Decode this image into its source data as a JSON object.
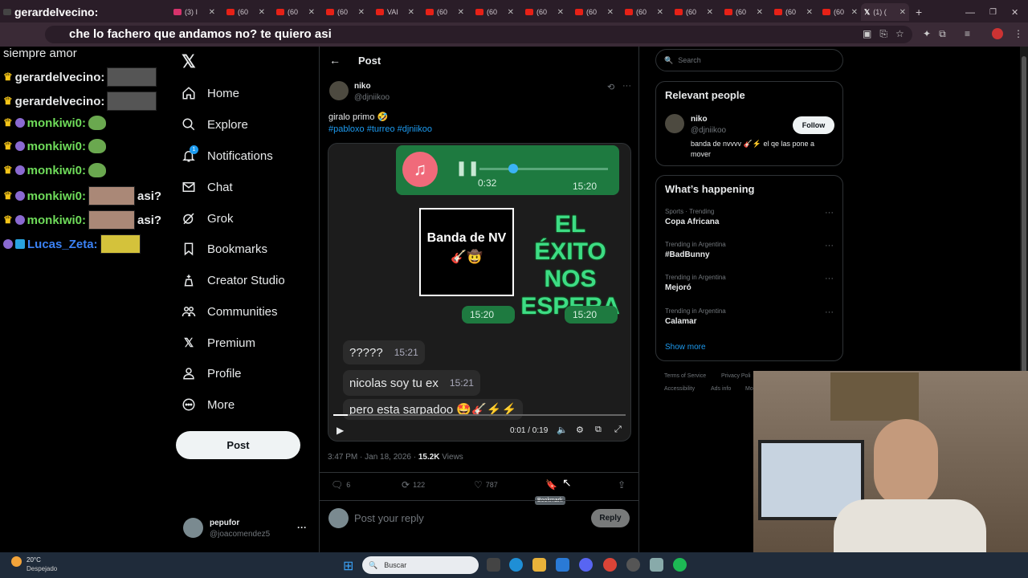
{
  "browser": {
    "tabs": [
      {
        "label": "gerardelvecino:"
      },
      {
        "label": "(3) I"
      },
      {
        "label": "(60"
      },
      {
        "label": "(60"
      },
      {
        "label": "(60"
      },
      {
        "label": "VAI"
      },
      {
        "label": "(60"
      },
      {
        "label": "(60"
      },
      {
        "label": "(60"
      },
      {
        "label": "(60"
      },
      {
        "label": "(60"
      },
      {
        "label": "(60"
      },
      {
        "label": "(60"
      },
      {
        "label": "(60"
      },
      {
        "label": "(60"
      },
      {
        "label": "(60"
      },
      {
        "label": "(60"
      }
    ],
    "active_tab": "(1) (",
    "new_tab": "+",
    "address_overlay": "che lo fachero que andamos no? te quiero asi"
  },
  "stream_chat": {
    "lines": [
      {
        "user": "",
        "text": "siempre amor"
      },
      {
        "user": "gerardelvecino:"
      },
      {
        "user": "gerardelvecino:"
      },
      {
        "user": "monkiwi0:"
      },
      {
        "user": "monkiwi0:"
      },
      {
        "user": "monkiwi0:"
      },
      {
        "user": "monkiwi0:",
        "text": "asi?"
      },
      {
        "user": "monkiwi0:",
        "text": "asi?"
      },
      {
        "user": "Lucas_Zeta:"
      }
    ]
  },
  "nav": {
    "items": [
      {
        "label": "Home",
        "icon": "home-icon"
      },
      {
        "label": "Explore",
        "icon": "search-icon"
      },
      {
        "label": "Notifications",
        "icon": "bell-icon",
        "badge": "1"
      },
      {
        "label": "Chat",
        "icon": "mail-icon"
      },
      {
        "label": "Grok",
        "icon": "grok-icon"
      },
      {
        "label": "Bookmarks",
        "icon": "bookmark-icon"
      },
      {
        "label": "Creator Studio",
        "icon": "creator-icon"
      },
      {
        "label": "Communities",
        "icon": "communities-icon"
      },
      {
        "label": "Premium",
        "icon": "x-icon"
      },
      {
        "label": "Profile",
        "icon": "person-icon"
      },
      {
        "label": "More",
        "icon": "more-icon"
      }
    ],
    "post_button": "Post",
    "account": {
      "name": "pepufor",
      "handle": "@joacomendez5",
      "more": "···"
    }
  },
  "post": {
    "header": "Post",
    "author": {
      "name": "niko",
      "handle": "@djniikoo"
    },
    "text": "giralo primo 🤣",
    "hashtags": "#pabloxo #turreo #djniikoo",
    "media": {
      "audio_time": "0:32",
      "bubble_time": "15:20",
      "sticker_text": "Banda de NV 🎸🤠",
      "big_text": "EL ÉXITO NOS ESPERA",
      "time_a": "15:20",
      "time_b": "15:20",
      "msg1": "?????",
      "msg1_time": "15:21",
      "msg2": "nicolas soy tu ex",
      "msg2_time": "15:21",
      "caption": "pero esta sarpadoo 🤩🎸⚡⚡",
      "video_time": "0:01 / 0:19",
      "progress": 0.05
    },
    "meta": {
      "time": "3:47 PM · Jan 18, 2026 · ",
      "views_count": "15.2K",
      "views_label": " Views"
    },
    "actions": {
      "replies": "6",
      "reposts": "122",
      "likes": "787",
      "tooltip": "Bookmark"
    },
    "reply_placeholder": "Post your reply",
    "reply_button": "Reply"
  },
  "sidebar": {
    "search_placeholder": "Search",
    "relevant": {
      "title": "Relevant people",
      "name": "niko",
      "handle": "@djniikoo",
      "bio": "banda de nvvvv 🎸⚡ el qe las pone a mover",
      "follow": "Follow"
    },
    "happening": {
      "title": "What’s happening",
      "trends": [
        {
          "category": "Sports · Trending",
          "name": "Copa Africana"
        },
        {
          "category": "Trending in Argentina",
          "name": "#BadBunny"
        },
        {
          "category": "Trending in Argentina",
          "name": "Mejoró"
        },
        {
          "category": "Trending in Argentina",
          "name": "Calamar"
        }
      ],
      "show_more": "Show more"
    },
    "footer": [
      "Terms of Service",
      "Privacy Poli",
      "Accessibility",
      "Ads info",
      "Mo"
    ]
  },
  "taskbar": {
    "weather_temp": "20°C",
    "weather_desc": "Despejado",
    "search": "Buscar"
  },
  "colors": {
    "accent": "#1d9bf0",
    "whatsapp_green": "#1e7a40",
    "neon_green": "#3ddc84"
  }
}
